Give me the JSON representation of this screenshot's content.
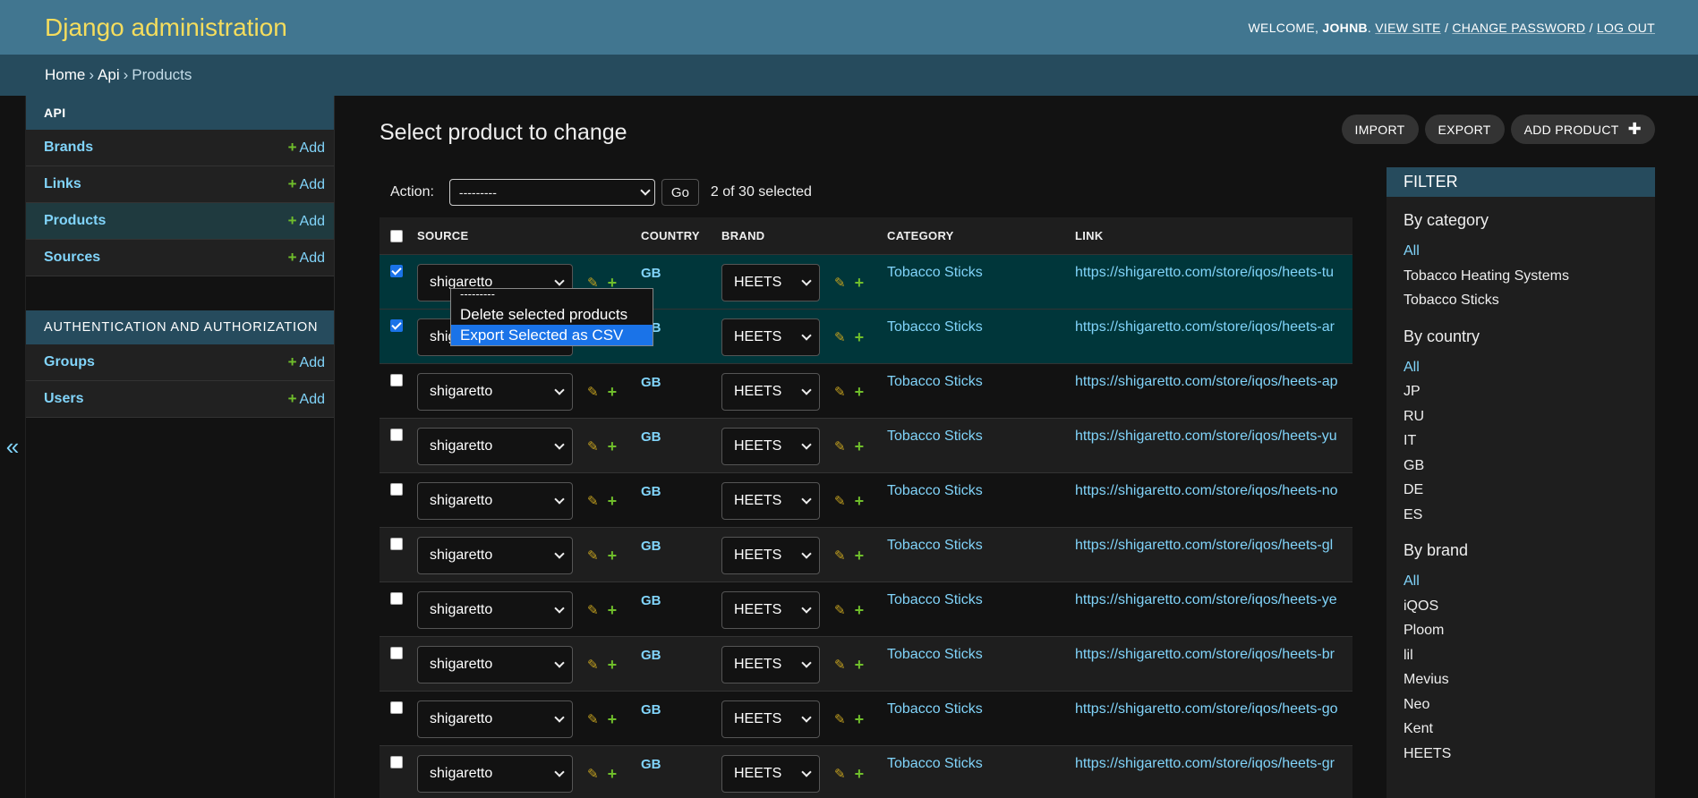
{
  "header": {
    "site_name": "Django administration",
    "welcome": "WELCOME,",
    "username": "JOHNB",
    "view_site": "VIEW SITE",
    "change_password": "CHANGE PASSWORD",
    "log_out": "LOG OUT"
  },
  "breadcrumbs": {
    "home": "Home",
    "app": "Api",
    "current": "Products"
  },
  "sidebar": {
    "api_caption": "API",
    "api_items": [
      {
        "label": "Brands",
        "add": "Add"
      },
      {
        "label": "Links",
        "add": "Add"
      },
      {
        "label": "Products",
        "add": "Add"
      },
      {
        "label": "Sources",
        "add": "Add"
      }
    ],
    "auth_caption": "AUTHENTICATION AND AUTHORIZATION",
    "auth_items": [
      {
        "label": "Groups",
        "add": "Add"
      },
      {
        "label": "Users",
        "add": "Add"
      }
    ],
    "toggle_icon": "«"
  },
  "page": {
    "title": "Select product to change",
    "import_label": "IMPORT",
    "export_label": "EXPORT",
    "add_label": "ADD PRODUCT"
  },
  "actions": {
    "label": "Action:",
    "selected_value": "---------",
    "go_label": "Go",
    "counter": "2 of 30 selected",
    "options": [
      "---------",
      "Delete selected products",
      "Export Selected as CSV"
    ],
    "highlighted_option": "Export Selected as CSV"
  },
  "table": {
    "headers": {
      "source": "SOURCE",
      "country": "COUNTRY",
      "brand": "BRAND",
      "category": "CATEGORY",
      "link": "LINK"
    },
    "rows": [
      {
        "checked": true,
        "source": "shigaretto",
        "country": "GB",
        "brand": "HEETS",
        "category": "Tobacco Sticks",
        "link": "https://shigaretto.com/store/iqos/heets-tu"
      },
      {
        "checked": true,
        "source": "shigaretto",
        "country": "GB",
        "brand": "HEETS",
        "category": "Tobacco Sticks",
        "link": "https://shigaretto.com/store/iqos/heets-ar"
      },
      {
        "checked": false,
        "source": "shigaretto",
        "country": "GB",
        "brand": "HEETS",
        "category": "Tobacco Sticks",
        "link": "https://shigaretto.com/store/iqos/heets-ap"
      },
      {
        "checked": false,
        "source": "shigaretto",
        "country": "GB",
        "brand": "HEETS",
        "category": "Tobacco Sticks",
        "link": "https://shigaretto.com/store/iqos/heets-yu"
      },
      {
        "checked": false,
        "source": "shigaretto",
        "country": "GB",
        "brand": "HEETS",
        "category": "Tobacco Sticks",
        "link": "https://shigaretto.com/store/iqos/heets-no"
      },
      {
        "checked": false,
        "source": "shigaretto",
        "country": "GB",
        "brand": "HEETS",
        "category": "Tobacco Sticks",
        "link": "https://shigaretto.com/store/iqos/heets-gl"
      },
      {
        "checked": false,
        "source": "shigaretto",
        "country": "GB",
        "brand": "HEETS",
        "category": "Tobacco Sticks",
        "link": "https://shigaretto.com/store/iqos/heets-ye"
      },
      {
        "checked": false,
        "source": "shigaretto",
        "country": "GB",
        "brand": "HEETS",
        "category": "Tobacco Sticks",
        "link": "https://shigaretto.com/store/iqos/heets-br"
      },
      {
        "checked": false,
        "source": "shigaretto",
        "country": "GB",
        "brand": "HEETS",
        "category": "Tobacco Sticks",
        "link": "https://shigaretto.com/store/iqos/heets-go"
      },
      {
        "checked": false,
        "source": "shigaretto",
        "country": "GB",
        "brand": "HEETS",
        "category": "Tobacco Sticks",
        "link": "https://shigaretto.com/store/iqos/heets-gr"
      }
    ]
  },
  "filter": {
    "heading": "FILTER",
    "groups": [
      {
        "title": "By category",
        "items": [
          "All",
          "Tobacco Heating Systems",
          "Tobacco Sticks"
        ]
      },
      {
        "title": "By country",
        "items": [
          "All",
          "JP",
          "RU",
          "IT",
          "GB",
          "DE",
          "ES"
        ]
      },
      {
        "title": "By brand",
        "items": [
          "All",
          "iQOS",
          "Ploom",
          "lil",
          "Mevius",
          "Neo",
          "Kent",
          "HEETS"
        ]
      }
    ]
  },
  "colors": {
    "header_bg": "#417690",
    "crumbs_bg": "#264b5d",
    "accent_yellow": "#f5dd5d",
    "link": "#81d4fa",
    "add_green": "#70bf2b",
    "selected_row": "#00363a"
  }
}
